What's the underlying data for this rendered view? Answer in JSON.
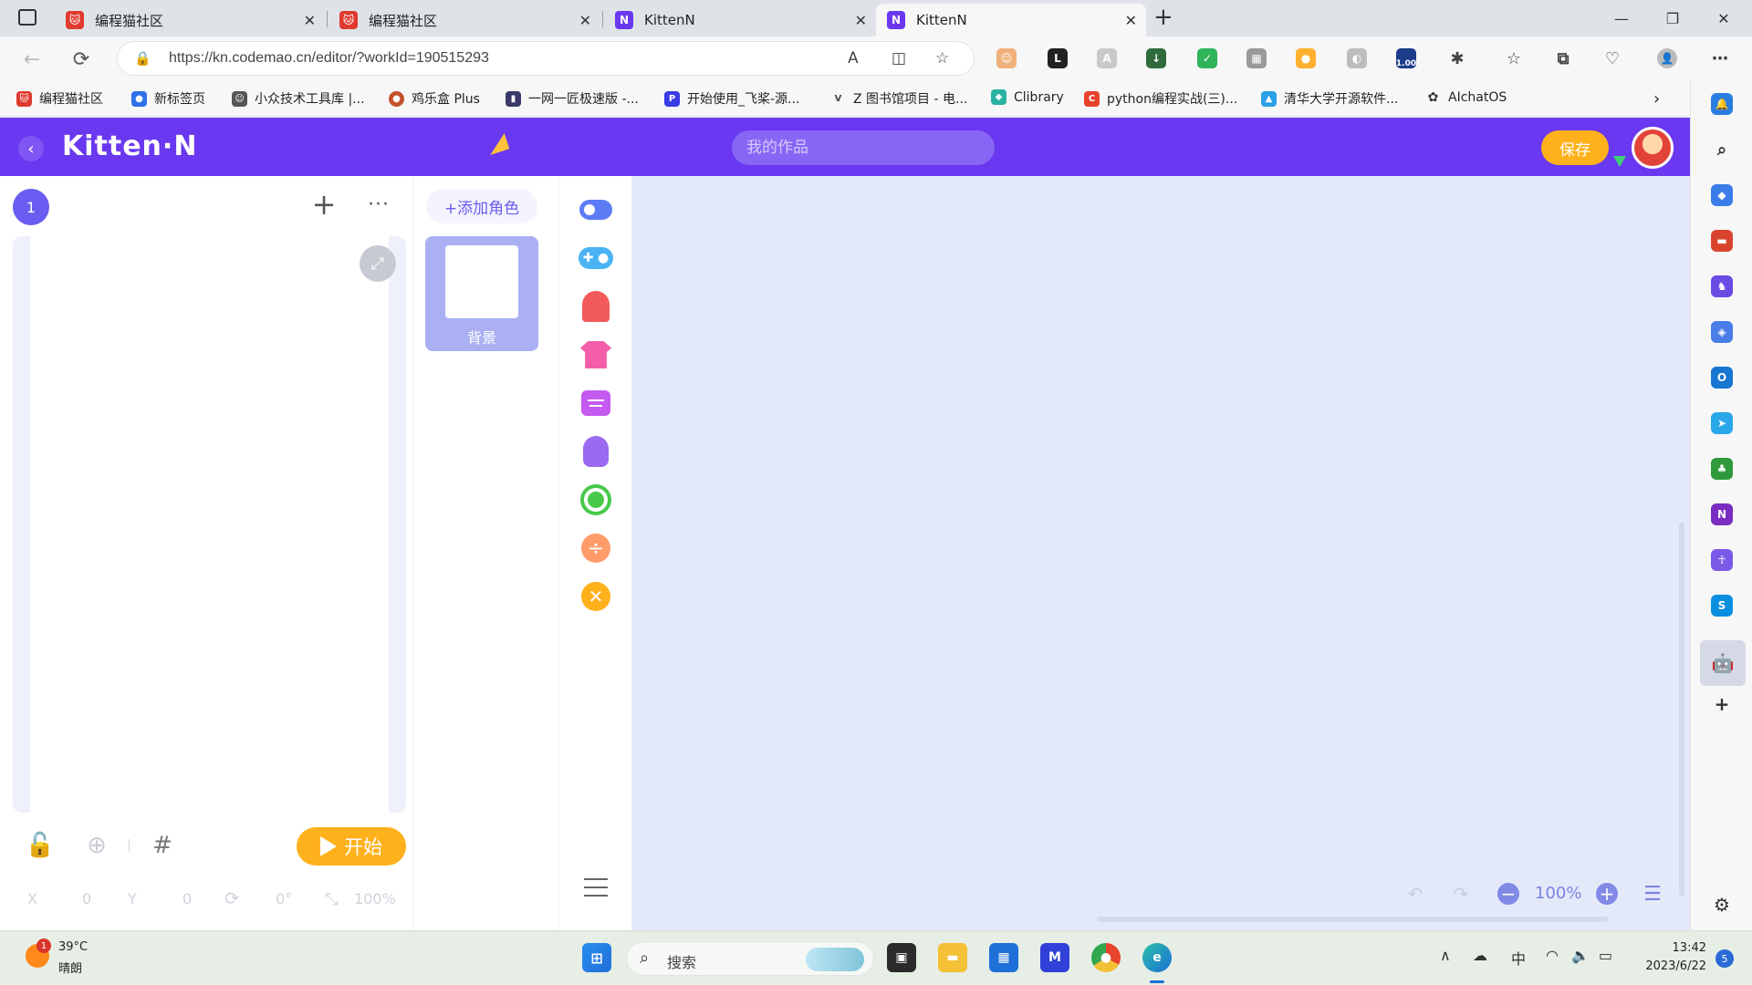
{
  "browser": {
    "tabs": [
      {
        "title": "编程猫社区",
        "favicon": "codemao-icon",
        "active": false
      },
      {
        "title": "编程猫社区",
        "favicon": "codemao-icon",
        "active": false
      },
      {
        "title": "KittenN",
        "favicon": "kitten-n-icon",
        "active": false
      },
      {
        "title": "KittenN",
        "favicon": "kitten-n-icon",
        "active": true
      }
    ],
    "url": "https://kn.codemao.cn/editor/?workId=190515293",
    "bookmarks": [
      {
        "label": "编程猫社区"
      },
      {
        "label": "新标签页"
      },
      {
        "label": "小众技术工具库 |..."
      },
      {
        "label": "鸡乐盒 Plus"
      },
      {
        "label": "一网一匠极速版 -..."
      },
      {
        "label": "开始使用_飞桨-源..."
      },
      {
        "label": "Z 图书馆项目 - 电..."
      },
      {
        "label": "Clibrary"
      },
      {
        "label": "python编程实战(三)..."
      },
      {
        "label": "清华大学开源软件..."
      },
      {
        "label": "AIchatOS"
      }
    ],
    "ext_badge": "1.00"
  },
  "app": {
    "brand": "Kitten·N",
    "work_placeholder": "我的作品",
    "save_label": "保存",
    "page_number": "1",
    "add_role_label": "+添加角色",
    "background_label": "背景",
    "start_label": "开始",
    "coords": {
      "x_label": "X",
      "x_value": "0",
      "y_label": "Y",
      "y_value": "0",
      "rotation": "0°",
      "scale": "100%"
    },
    "zoom": "100%",
    "categories": [
      {
        "icon": "event-toggle-icon",
        "color": "#5b7cf5"
      },
      {
        "icon": "gamepad-icon",
        "color": "#4ab3f4"
      },
      {
        "icon": "ghost-icon",
        "color": "#f35a5a"
      },
      {
        "icon": "shirt-icon",
        "color": "#f45ea8"
      },
      {
        "icon": "chat-bubble-icon",
        "color": "#c35bf0"
      },
      {
        "icon": "lightbulb-icon",
        "color": "#9a6af0"
      },
      {
        "icon": "green-circle-icon",
        "color": "#48c94a"
      },
      {
        "icon": "divide-icon",
        "color": "#ff9c6a"
      },
      {
        "icon": "multiply-icon",
        "color": "#ffb11c"
      }
    ]
  },
  "taskbar": {
    "weather_temp": "39°C",
    "weather_desc": "晴朗",
    "weather_badge": "1",
    "search_label": "搜索",
    "ime": "中",
    "time": "13:42",
    "date": "2023/6/22",
    "notifications": "5"
  }
}
